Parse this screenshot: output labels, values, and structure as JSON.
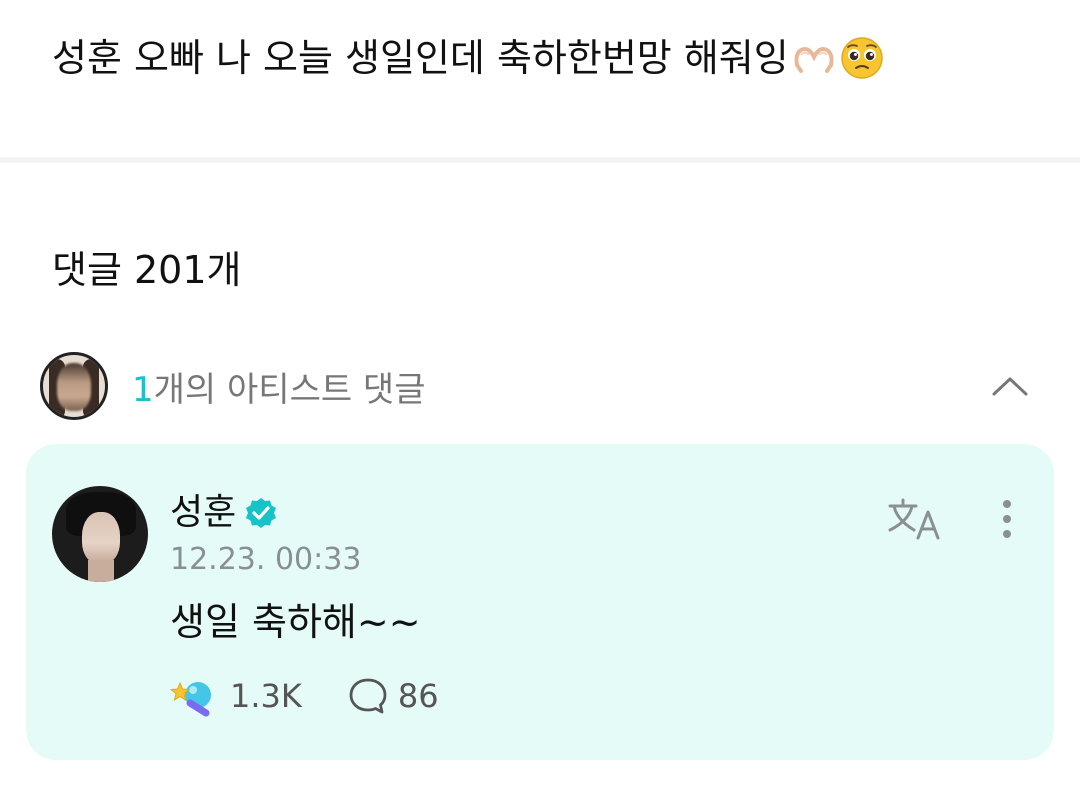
{
  "post": {
    "text": "성훈 오빠 나 오늘 생일인데 축하한번망 해줘잉",
    "emojis": [
      "heart-hands",
      "pleading-face"
    ]
  },
  "comments": {
    "count_label": "댓글 201개"
  },
  "artist_section": {
    "count": "1",
    "label": "개의 아티스트 댓글",
    "accent_color": "#17c2c9"
  },
  "artist_comment": {
    "author": "성훈",
    "verified": true,
    "timestamp": "12.23. 00:33",
    "text": "생일 축하해~~",
    "cheers": "1.3K",
    "replies": "86",
    "card_color": "#e5fbf8"
  }
}
